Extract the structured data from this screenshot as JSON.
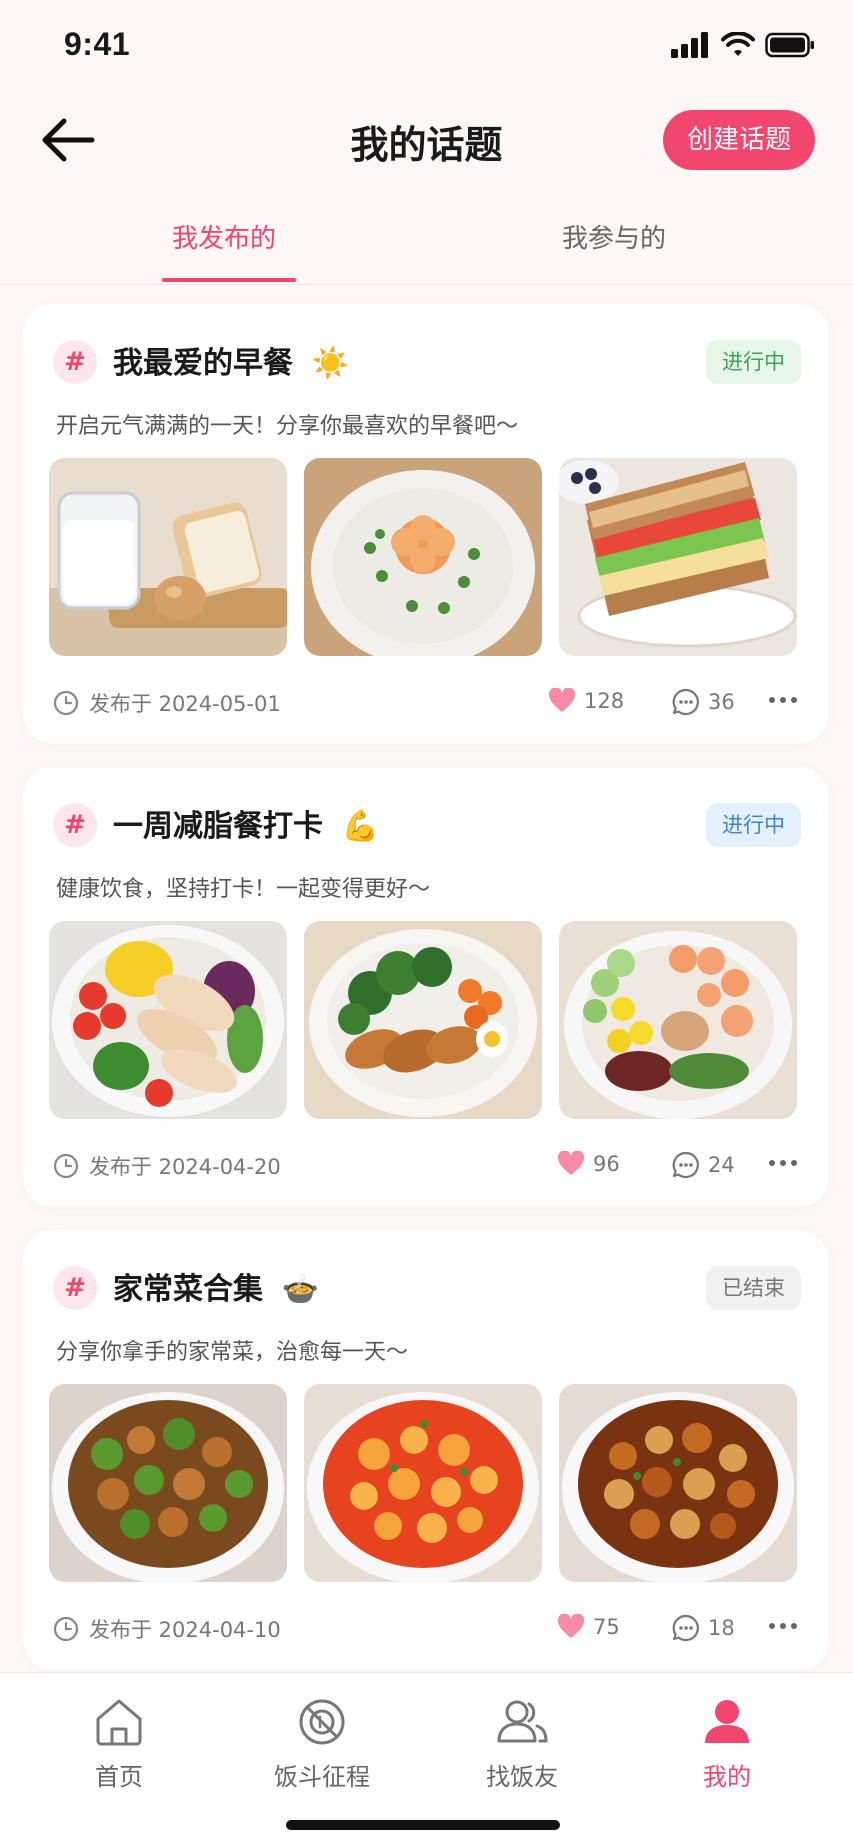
{
  "status_bar": {
    "time": "9:41"
  },
  "header": {
    "title": "我的话题",
    "create_label": "创建话题"
  },
  "tabs": [
    {
      "label": "我发布的",
      "active": true
    },
    {
      "label": "我参与的",
      "active": false
    }
  ],
  "topics": [
    {
      "title": "我最爱的早餐",
      "emoji": "☀️",
      "status": "进行中",
      "description": "开启元气满满的一天！分享你最喜欢的早餐吧～",
      "images": [
        "milk-and-toast",
        "shrimp-congee",
        "sandwich"
      ],
      "date": "发布于 2024-05-01",
      "likes": "128",
      "comments": "36"
    },
    {
      "title": "一周减脂餐打卡",
      "emoji": "💪",
      "status": "进行中",
      "description": "健康饮食，坚持打卡！一起变得更好～",
      "images": [
        "chicken-salad-bowl",
        "grilled-chicken-broccoli",
        "shrimp-salad-bowl"
      ],
      "date": "发布于 2024-04-20",
      "likes": "96",
      "comments": "24"
    },
    {
      "title": "家常菜合集",
      "emoji": "🍲",
      "status": "已结束",
      "description": "分享你拿手的家常菜，治愈每一天～",
      "images": [
        "pepper-stir-fry",
        "tomato-egg",
        "braised-dish"
      ],
      "date": "发布于 2024-04-10",
      "likes": "75",
      "comments": "18"
    }
  ],
  "bottom_nav": [
    {
      "label": "首页",
      "icon": "home-icon",
      "active": false
    },
    {
      "label": "饭斗征程",
      "icon": "journey-icon",
      "active": false
    },
    {
      "label": "找饭友",
      "icon": "friends-icon",
      "active": false
    },
    {
      "label": "我的",
      "icon": "profile-icon",
      "active": true
    }
  ],
  "colors": {
    "accent": "#f2466f",
    "green_badge": "#3aa655",
    "blue_badge": "#3a86d6",
    "grey_badge": "#777777"
  }
}
